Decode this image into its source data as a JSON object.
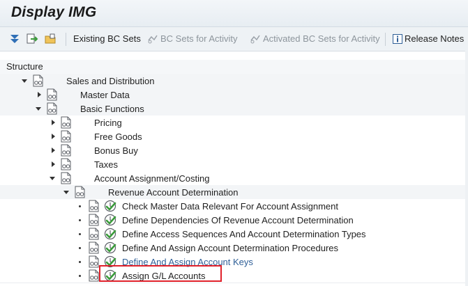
{
  "window": {
    "title": "Display IMG"
  },
  "toolbar": {
    "existing_bc_sets": "Existing BC Sets",
    "bc_sets_for_activity": "BC Sets for Activity",
    "activated_bc_sets": "Activated BC Sets for Activity",
    "release_notes": "Release Notes"
  },
  "tree": {
    "header": "Structure",
    "nodes": [
      {
        "label": "Sales and Distribution"
      },
      {
        "label": "Master Data"
      },
      {
        "label": "Basic Functions"
      },
      {
        "label": "Pricing"
      },
      {
        "label": "Free Goods"
      },
      {
        "label": "Bonus Buy"
      },
      {
        "label": "Taxes"
      },
      {
        "label": "Account Assignment/Costing"
      },
      {
        "label": "Revenue Account Determination"
      },
      {
        "label": "Check Master Data Relevant For Account Assignment"
      },
      {
        "label": "Define Dependencies Of Revenue Account Determination"
      },
      {
        "label": "Define Access Sequences And Account Determination Types"
      },
      {
        "label": "Define And Assign Account Determination Procedures"
      },
      {
        "label": "Define And Assign Account Keys"
      },
      {
        "label": "Assign G/L Accounts"
      }
    ]
  },
  "colors": {
    "highlight": "#e0202a",
    "link": "#2f5f97",
    "activity_check": "#3a9b3a"
  }
}
